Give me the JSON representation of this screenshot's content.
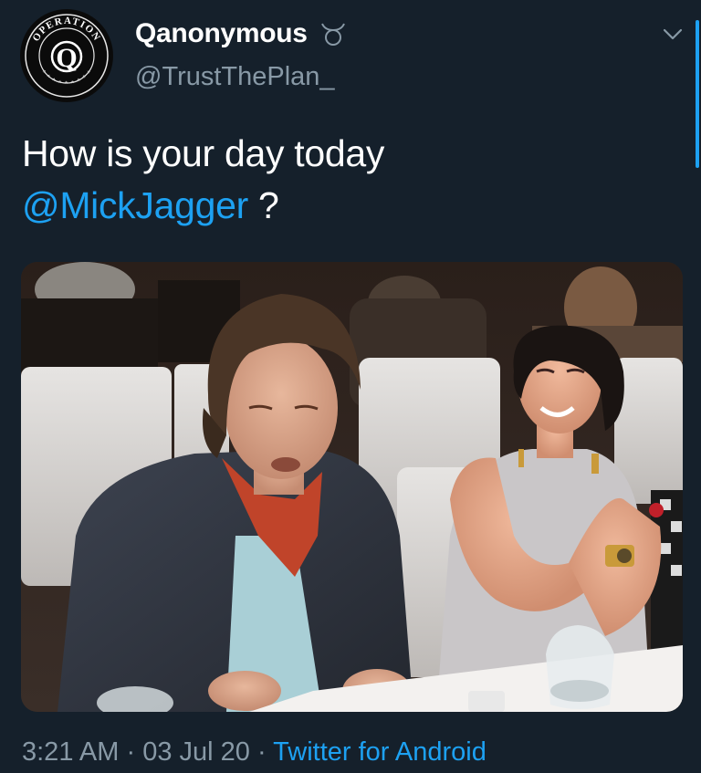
{
  "user": {
    "display_name": "Qanonymous",
    "handle": "@TrustThePlan_",
    "avatar_icon": "operation-q-seal-icon",
    "name_badge_icon": "taurus-icon",
    "avatar_text_top": "OPERATION",
    "avatar_letter": "Q"
  },
  "tweet": {
    "text_line1": "How is your day today",
    "mention": "@MickJagger",
    "text_after_mention": " ?",
    "photo_alt_icon": "photo-two-people-at-dinner-table"
  },
  "meta": {
    "time": "3:21 AM",
    "separator": " · ",
    "date": "03 Jul 20",
    "source": "Twitter for Android"
  },
  "controls": {
    "menu_icon": "chevron-down-icon"
  },
  "colors": {
    "background": "#15202b",
    "accent": "#1da1f2",
    "secondary_text": "#8899a6"
  }
}
